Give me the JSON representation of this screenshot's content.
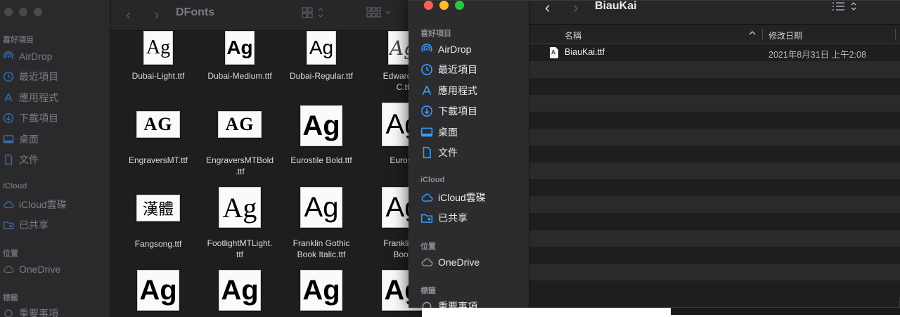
{
  "back_window": {
    "title": "DFonts",
    "sidebar": {
      "favorites_header": "喜好項目",
      "favorites": [
        {
          "label": "AirDrop",
          "icon": "airdrop-icon"
        },
        {
          "label": "最近項目",
          "icon": "clock-icon"
        },
        {
          "label": "應用程式",
          "icon": "apps-icon"
        },
        {
          "label": "下載項目",
          "icon": "download-icon"
        },
        {
          "label": "桌面",
          "icon": "desktop-icon"
        },
        {
          "label": "文件",
          "icon": "document-icon"
        }
      ],
      "icloud_header": "iCloud",
      "icloud": [
        {
          "label": "iCloud雲碟",
          "icon": "cloud-icon"
        },
        {
          "label": "已共享",
          "icon": "shared-folder-icon"
        }
      ],
      "locations_header": "位置",
      "locations": [
        {
          "label": "OneDrive",
          "icon": "cloud-icon"
        }
      ],
      "tags_header": "標籤",
      "tags": [
        {
          "label": "重要事項",
          "icon": "tag-circle-icon"
        }
      ]
    },
    "files": [
      {
        "name": "Dubai-Light.ttf",
        "preview": "Ag"
      },
      {
        "name": "Dubai-Medium.ttf",
        "preview": "Ag"
      },
      {
        "name": "Dubai-Regular.ttf",
        "preview": "Ag"
      },
      {
        "name": "EdwardianScriptITC.ttf",
        "preview": "Ag"
      },
      {
        "name": "EngraversMT.ttf",
        "preview": "AG"
      },
      {
        "name": "EngraversMTBold.ttf",
        "preview": "AG"
      },
      {
        "name": "Eurostile Bold.ttf",
        "preview": "Ag"
      },
      {
        "name": "Eurostile.ttf",
        "preview": "Ag"
      },
      {
        "name": "Fangsong.ttf",
        "preview": "漢體"
      },
      {
        "name": "FootlightMTLight.ttf",
        "preview": "Ag"
      },
      {
        "name": "Franklin Gothic Book Italic.ttf",
        "preview": "Ag"
      },
      {
        "name": "Franklin Gothic Book.ttf",
        "preview": "Ag"
      },
      {
        "name": "",
        "preview": "Ag"
      },
      {
        "name": "",
        "preview": "Ag"
      },
      {
        "name": "",
        "preview": "Ag"
      },
      {
        "name": "",
        "preview": "Ag"
      }
    ],
    "visible_file_labels": {
      "c1": "Dubai-Light.ttf",
      "c2": "Dubai-Medium.ttf",
      "c3": "Dubai-Regular.ttf",
      "c4": "Edwardian\nC.tt",
      "c5": "EngraversMT.ttf",
      "c6": "EngraversMTBold\n.ttf",
      "c7": "Eurostile Bold.ttf",
      "c8": "Eurosti",
      "c9": "Fangsong.ttf",
      "c10": "FootlightMTLight.\nttf",
      "c11": "Franklin Gothic\nBook Italic.ttf",
      "c12": "Franklin G\nBook"
    }
  },
  "front_window": {
    "title": "BiauKai",
    "sidebar": {
      "favorites_header": "喜好項目",
      "favorites": [
        {
          "label": "AirDrop",
          "icon": "airdrop-icon"
        },
        {
          "label": "最近項目",
          "icon": "clock-icon"
        },
        {
          "label": "應用程式",
          "icon": "apps-icon"
        },
        {
          "label": "下載項目",
          "icon": "download-icon"
        },
        {
          "label": "桌面",
          "icon": "desktop-icon"
        },
        {
          "label": "文件",
          "icon": "document-icon"
        }
      ],
      "icloud_header": "iCloud",
      "icloud": [
        {
          "label": "iCloud雲碟",
          "icon": "cloud-icon"
        },
        {
          "label": "已共享",
          "icon": "shared-folder-icon"
        }
      ],
      "locations_header": "位置",
      "locations": [
        {
          "label": "OneDrive",
          "icon": "cloud-icon"
        }
      ],
      "tags_header": "標籤",
      "tags": [
        {
          "label": "重要事項",
          "icon": "tag-circle-icon"
        }
      ]
    },
    "columns": {
      "name": "名稱",
      "date": "修改日期"
    },
    "files": [
      {
        "name": "BiauKai.ttf",
        "modified": "2021年8月31日 上午2:08"
      }
    ]
  },
  "colors": {
    "accent_blue": "#3b9bff",
    "light_red": "#ff5f57",
    "light_yellow": "#febc2e",
    "light_green": "#28c840"
  }
}
